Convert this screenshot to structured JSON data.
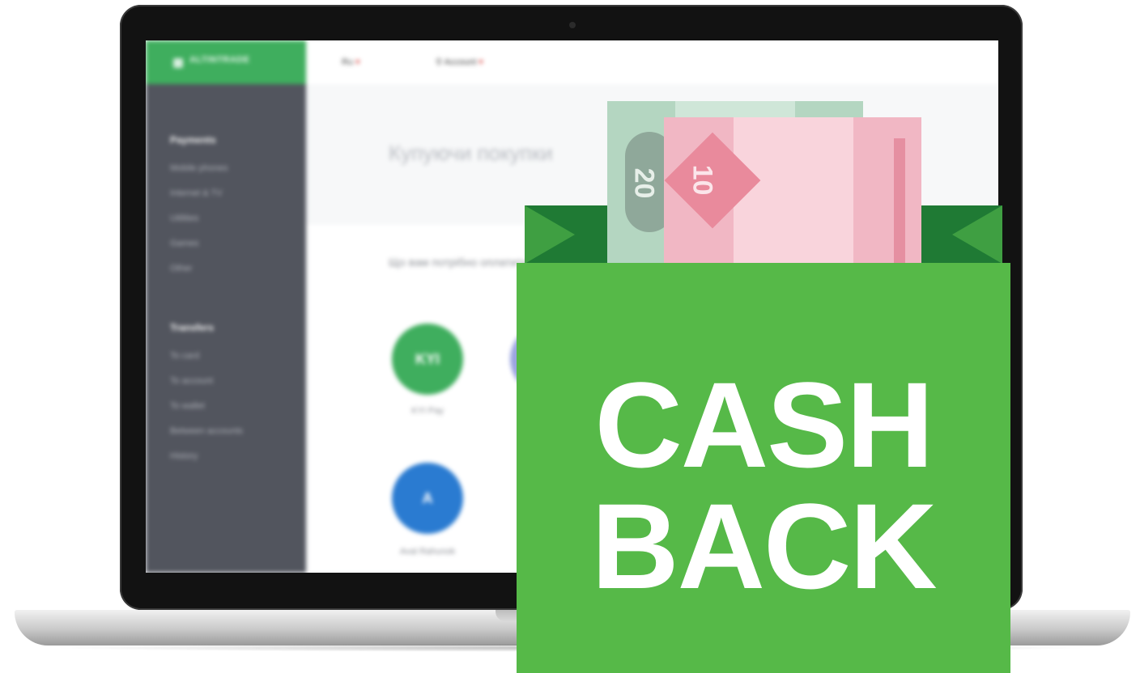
{
  "app": {
    "brand": "ALTINTRADE",
    "topbar": {
      "language": "Ru",
      "user": "Account"
    },
    "sidebar": {
      "sections": [
        {
          "heading": "Payments",
          "items": [
            "Mobile phones",
            "Internet & TV",
            "Utilities",
            "Games",
            "Other"
          ]
        },
        {
          "heading": "Transfers",
          "items": [
            "To card",
            "To account",
            "To wallet",
            "Between accounts",
            "History"
          ]
        }
      ]
    },
    "hero_title": "Купуючи покупки",
    "content_subtitle": "Що вам потрібно оплатити?",
    "services": [
      {
        "label": "KYI",
        "caption": "KYI Pay",
        "color": "#3fae5e"
      },
      {
        "label": "A",
        "caption": "Aval Rahunok",
        "color": "#2a7bd1"
      }
    ]
  },
  "banknotes": [
    {
      "value": "20",
      "color": "#cfe6d8"
    },
    {
      "value": "10",
      "color": "#f9d4dc"
    }
  ],
  "banner": {
    "line1": "CASH",
    "line2": "BACK",
    "color": "#56b948",
    "text_color": "#ffffff"
  }
}
